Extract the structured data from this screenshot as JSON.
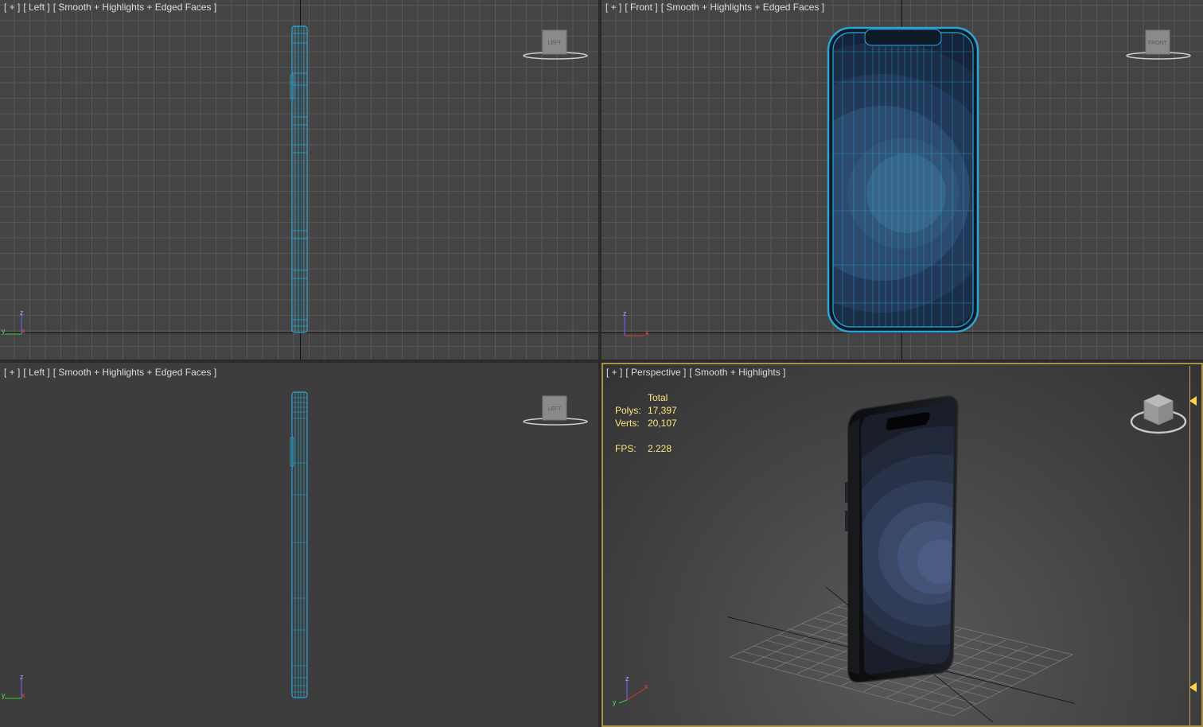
{
  "viewports": [
    {
      "id": "top-left",
      "plus": "[ + ]",
      "view": "[ Left ]",
      "shading": "[ Smooth + Highlights + Edged Faces ]",
      "navcube": "LEFT"
    },
    {
      "id": "top-right",
      "plus": "[ + ]",
      "view": "[ Front ]",
      "shading": "[ Smooth + Highlights + Edged Faces ]",
      "navcube": "FRONT"
    },
    {
      "id": "bottom-left",
      "plus": "[ + ]",
      "view": "[ Left ]",
      "shading": "[ Smooth + Highlights + Edged Faces ]",
      "navcube": "LEFT"
    },
    {
      "id": "bottom-right",
      "plus": "[ + ]",
      "view": "[ Perspective ]",
      "shading": "[ Smooth + Highlights ]"
    }
  ],
  "stats": {
    "header": "Total",
    "polys_label": "Polys:",
    "polys_value": "17,397",
    "verts_label": "Verts:",
    "verts_value": "20,107",
    "fps_label": "FPS:",
    "fps_value": "2.228"
  },
  "axes": {
    "x": "x",
    "y": "y",
    "z": "z"
  },
  "colors": {
    "wire": "#2aa6d4",
    "active_border": "#a8924a",
    "stats_text": "#ffe680",
    "axis_x": "#d33",
    "axis_y": "#3c3",
    "axis_z": "#66f"
  }
}
